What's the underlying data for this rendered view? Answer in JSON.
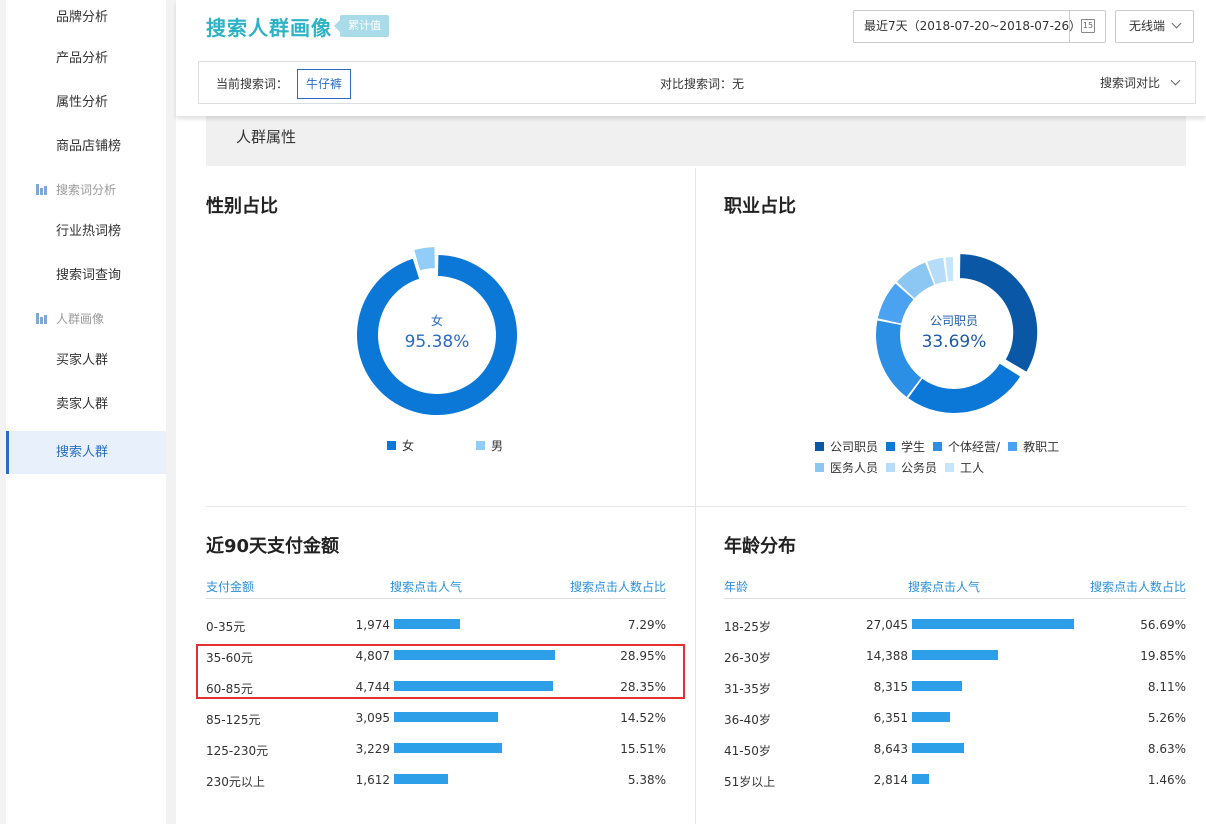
{
  "sidebar": {
    "items": [
      {
        "label": "品牌分析",
        "type": "item"
      },
      {
        "label": "产品分析",
        "type": "item"
      },
      {
        "label": "属性分析",
        "type": "item"
      },
      {
        "label": "商品店铺榜",
        "type": "item"
      },
      {
        "label": "搜索词分析",
        "type": "group"
      },
      {
        "label": "行业热词榜",
        "type": "item"
      },
      {
        "label": "搜索词查询",
        "type": "item"
      },
      {
        "label": "人群画像",
        "type": "group"
      },
      {
        "label": "买家人群",
        "type": "item"
      },
      {
        "label": "卖家人群",
        "type": "item"
      },
      {
        "label": "搜索人群",
        "type": "item",
        "active": true
      }
    ]
  },
  "header": {
    "title": "搜索人群画像",
    "badge": "累计值",
    "date_range": "最近7天（2018-07-20~2018-07-26）",
    "calendar_day": "15",
    "device": "无线端"
  },
  "search": {
    "current_label": "当前搜索词：",
    "keyword": "牛仔裤",
    "compare_label": "对比搜索词：无",
    "compare_button": "搜索词对比"
  },
  "section": {
    "title": "人群属性"
  },
  "gender": {
    "title": "性别占比",
    "center_label": "女",
    "center_value": "95.38%",
    "legend": [
      {
        "label": "女",
        "color": "#0b78d7"
      },
      {
        "label": "男",
        "color": "#91cdf6"
      }
    ]
  },
  "occupation": {
    "title": "职业占比",
    "center_label": "公司职员",
    "center_value": "33.69%",
    "legend": [
      {
        "label": "公司职员",
        "color": "#0957a5"
      },
      {
        "label": "学生",
        "color": "#0b78d7"
      },
      {
        "label": "个体经营/",
        "color": "#2b8fe6"
      },
      {
        "label": "教职工",
        "color": "#4aa2f0"
      },
      {
        "label": "医务人员",
        "color": "#8cc6f3"
      },
      {
        "label": "公务员",
        "color": "#b5dcf8"
      },
      {
        "label": "工人",
        "color": "#c6e5fb"
      }
    ]
  },
  "payment": {
    "title": "近90天支付金额",
    "headers": [
      "支付金额",
      "搜索点击人气",
      "搜索点击人数占比"
    ],
    "rows": [
      {
        "label": "0-35元",
        "value": "1,974",
        "pct": "7.29%"
      },
      {
        "label": "35-60元",
        "value": "4,807",
        "pct": "28.95%"
      },
      {
        "label": "60-85元",
        "value": "4,744",
        "pct": "28.35%"
      },
      {
        "label": "85-125元",
        "value": "3,095",
        "pct": "14.52%"
      },
      {
        "label": "125-230元",
        "value": "3,229",
        "pct": "15.51%"
      },
      {
        "label": "230元以上",
        "value": "1,612",
        "pct": "5.38%"
      }
    ]
  },
  "age": {
    "title": "年龄分布",
    "headers": [
      "年龄",
      "搜索点击人气",
      "搜索点击人数占比"
    ],
    "rows": [
      {
        "label": "18-25岁",
        "value": "27,045",
        "pct": "56.69%"
      },
      {
        "label": "26-30岁",
        "value": "14,388",
        "pct": "19.85%"
      },
      {
        "label": "31-35岁",
        "value": "8,315",
        "pct": "8.11%"
      },
      {
        "label": "36-40岁",
        "value": "6,351",
        "pct": "5.26%"
      },
      {
        "label": "41-50岁",
        "value": "8,643",
        "pct": "8.63%"
      },
      {
        "label": "51岁以上",
        "value": "2,814",
        "pct": "1.46%"
      }
    ]
  },
  "chart_data": [
    {
      "type": "pie",
      "title": "性别占比",
      "categories": [
        "女",
        "男"
      ],
      "values": [
        95.38,
        4.62
      ],
      "colors": [
        "#0b78d7",
        "#91cdf6"
      ]
    },
    {
      "type": "pie",
      "title": "职业占比",
      "categories": [
        "公司职员",
        "学生",
        "个体经营/",
        "教职工",
        "医务人员",
        "公务员",
        "工人"
      ],
      "values": [
        33.69,
        26.5,
        18.0,
        8.5,
        7.5,
        3.8,
        2.0
      ],
      "colors": [
        "#0957a5",
        "#0b78d7",
        "#2b8fe6",
        "#4aa2f0",
        "#8cc6f3",
        "#b5dcf8",
        "#c6e5fb"
      ]
    },
    {
      "type": "bar",
      "title": "近90天支付金额",
      "categories": [
        "0-35元",
        "35-60元",
        "60-85元",
        "85-125元",
        "125-230元",
        "230元以上"
      ],
      "values": [
        1974,
        4807,
        4744,
        3095,
        3229,
        1612
      ]
    },
    {
      "type": "bar",
      "title": "年龄分布",
      "categories": [
        "18-25岁",
        "26-30岁",
        "31-35岁",
        "36-40岁",
        "41-50岁",
        "51岁以上"
      ],
      "values": [
        27045,
        14388,
        8315,
        6351,
        8643,
        2814
      ]
    }
  ]
}
